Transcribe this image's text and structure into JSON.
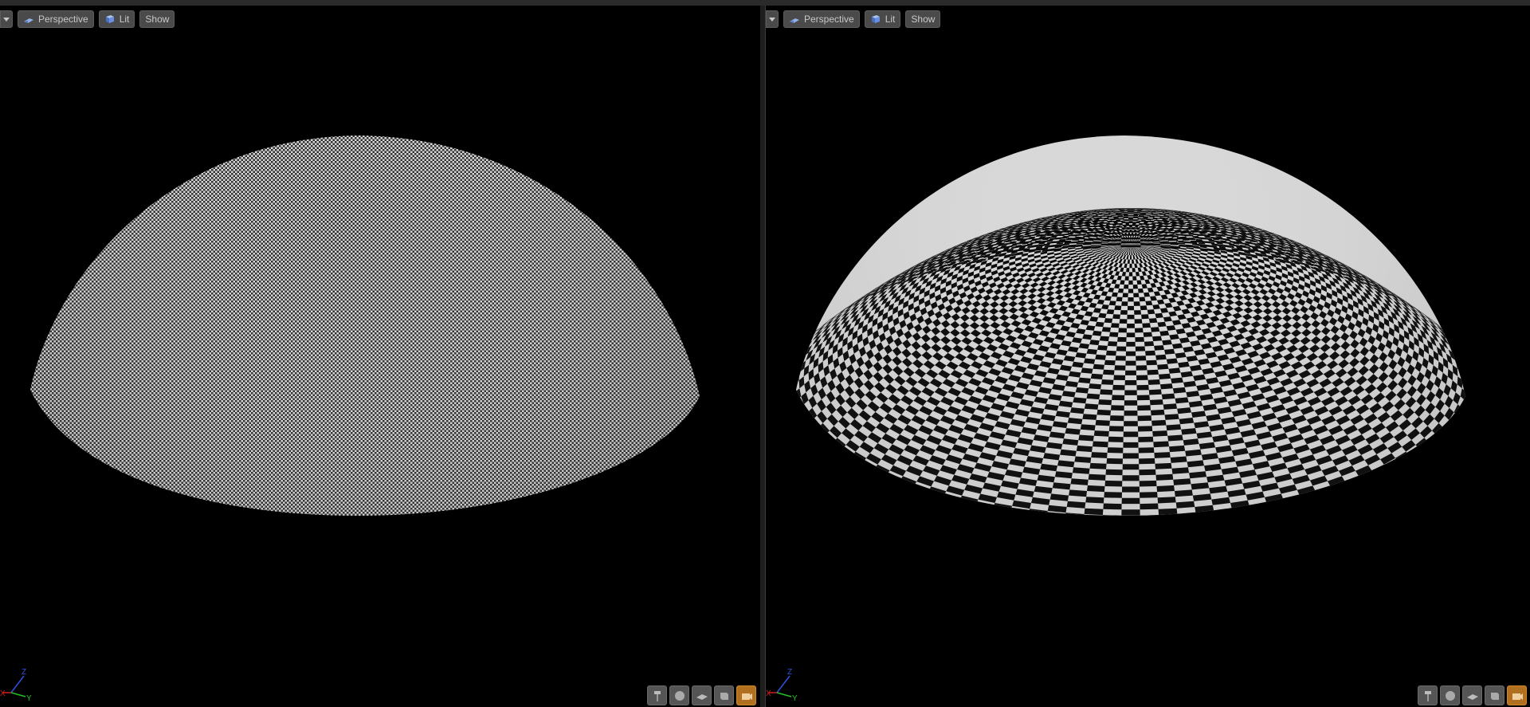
{
  "viewports": [
    {
      "id": "left",
      "toolbar": {
        "perspective_label": "Perspective",
        "lit_label": "Lit",
        "show_label": "Show"
      },
      "mesh": {
        "pattern": "fine-uniform-checker",
        "color_light": "#d8d8d8",
        "color_dark": "#1a1a1a"
      },
      "axis": {
        "z_label": "Z",
        "y_label": "Y",
        "x_label": "X"
      },
      "bottom_tools": [
        "brush-icon",
        "sphere-icon",
        "plane-icon",
        "cube-icon",
        "camera-icon"
      ]
    },
    {
      "id": "right",
      "toolbar": {
        "perspective_label": "Perspective",
        "lit_label": "Lit",
        "show_label": "Show"
      },
      "mesh": {
        "pattern": "pole-distorted-checker",
        "color_light": "#d8d8d8",
        "color_dark": "#050505"
      },
      "axis": {
        "z_label": "Z",
        "y_label": "Y",
        "x_label": "X"
      },
      "bottom_tools": [
        "brush-icon",
        "sphere-icon",
        "plane-icon",
        "cube-icon",
        "camera-icon"
      ]
    }
  ],
  "colors": {
    "axis_x": "#d02020",
    "axis_y": "#20c020",
    "axis_z": "#3050e0",
    "active_tool": "#b07020"
  }
}
